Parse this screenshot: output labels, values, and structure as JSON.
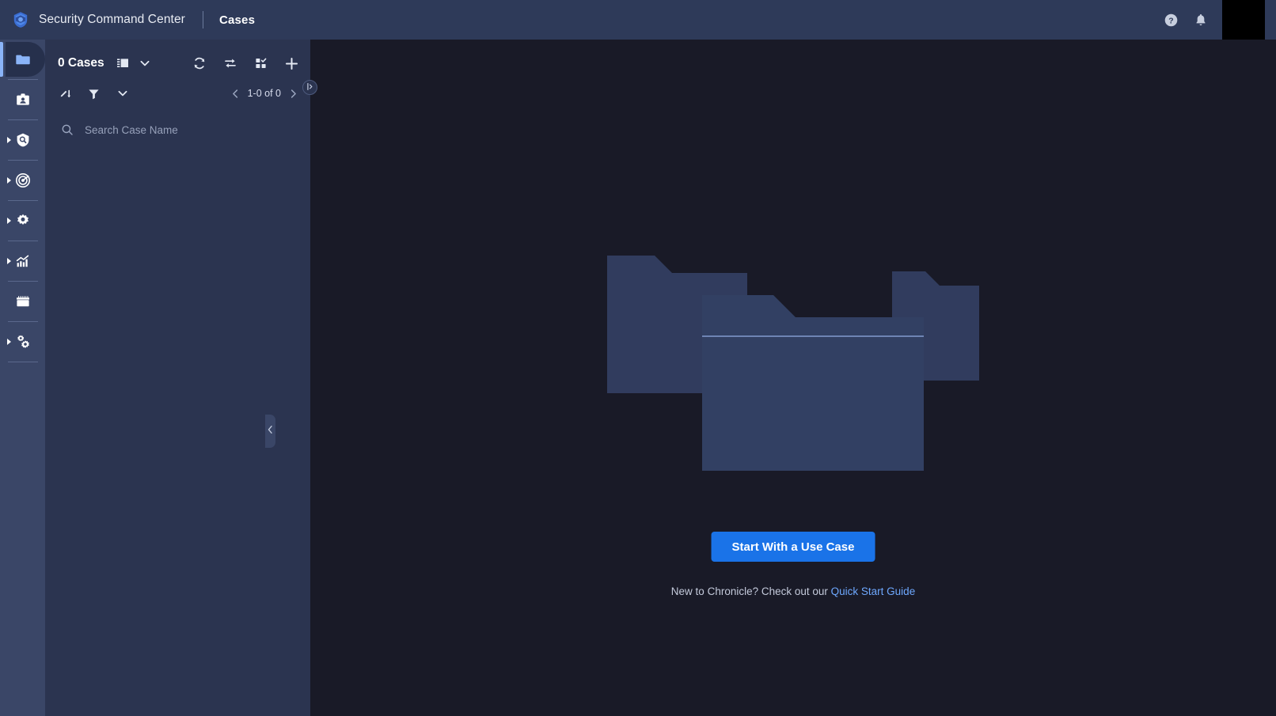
{
  "topbar": {
    "brand": "Security Command Center",
    "section": "Cases",
    "logo_icon": "shield-logo-icon",
    "help_icon": "help-circle-icon",
    "notifications_icon": "bell-icon",
    "avatar_icon": "avatar"
  },
  "sidebar": {
    "items": [
      {
        "name": "cases",
        "icon": "folder-icon",
        "active": true,
        "expandable": false
      },
      {
        "name": "entities",
        "icon": "id-badge-icon",
        "active": false,
        "expandable": false
      },
      {
        "name": "investigation",
        "icon": "shield-search-icon",
        "active": false,
        "expandable": true
      },
      {
        "name": "detection",
        "icon": "radar-icon",
        "active": false,
        "expandable": true
      },
      {
        "name": "settings",
        "icon": "gear-icon",
        "active": false,
        "expandable": true
      },
      {
        "name": "reports",
        "icon": "chart-bars-icon",
        "active": false,
        "expandable": true
      },
      {
        "name": "marketplace",
        "icon": "storefront-icon",
        "active": false,
        "expandable": false
      },
      {
        "name": "administration",
        "icon": "cogs-icon",
        "active": false,
        "expandable": true
      }
    ]
  },
  "cases_panel": {
    "count_label": "0 Cases",
    "view_mode_icon": "split-view-icon",
    "view_mode_chevron_icon": "chevron-down-icon",
    "actions": [
      {
        "name": "refresh",
        "icon": "refresh-icon"
      },
      {
        "name": "swap",
        "icon": "swap-arrows-icon"
      },
      {
        "name": "bulk-select",
        "icon": "grid-select-icon"
      },
      {
        "name": "add-case",
        "icon": "plus-icon"
      }
    ],
    "sub_actions": [
      {
        "name": "sort",
        "icon": "sort-icon"
      },
      {
        "name": "filter",
        "icon": "filter-funnel-icon"
      },
      {
        "name": "more",
        "icon": "chevron-down-icon"
      }
    ],
    "pagination": {
      "prev_icon": "chevron-left-icon",
      "next_icon": "chevron-right-icon",
      "label": "1-0 of 0"
    },
    "search": {
      "icon": "search-icon",
      "placeholder": "Search Case Name",
      "value": ""
    },
    "expand_handle_icon": "expand-panel-icon",
    "collapse_handle_icon": "chevron-left-icon"
  },
  "main": {
    "illustration_name": "empty-folders-illustration",
    "cta_label": "Start With a Use Case",
    "hint_prefix": "New to Chronicle? Check out our ",
    "hint_link": "Quick Start Guide"
  },
  "colors": {
    "topbar_bg": "#2e3a59",
    "rail_bg": "#3a4667",
    "panel_bg": "#2b3450",
    "main_bg": "#191a27",
    "accent_blue": "#1a73e8",
    "link_blue": "#6ea8fe",
    "active_indicator": "#8ab4f8",
    "folder_fill": "#2f3b5c"
  }
}
